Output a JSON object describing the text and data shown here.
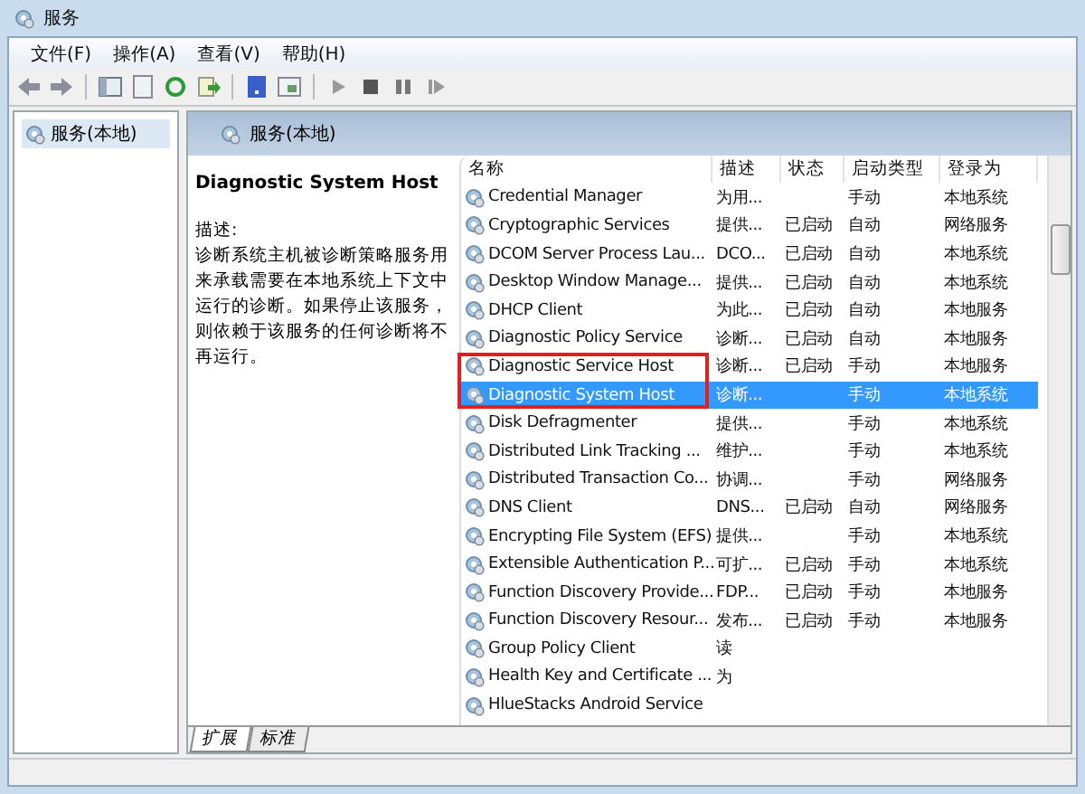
{
  "window": {
    "title": "服务"
  },
  "menu": [
    "文件(F)",
    "操作(A)",
    "查看(V)",
    "帮助(H)"
  ],
  "tree": [
    {
      "label": "服务(本地)",
      "selected": true
    }
  ],
  "pane_title": "服务(本地)",
  "details": {
    "title": "Diagnostic System Host",
    "desc_label": "描述:",
    "description": "诊断系统主机被诊断策略服务用来承载需要在本地系统上下文中运行的诊断。如果停止该服务，则依赖于该服务的任何诊断将不再运行。"
  },
  "table": {
    "columns": [
      "名称",
      "描述",
      "状态",
      "启动类型",
      "登录为"
    ],
    "rows": [
      {
        "cells": [
          "Credential Manager",
          "为用...",
          "",
          "手动",
          "本地系统"
        ],
        "selected": false,
        "highlighted": false
      },
      {
        "cells": [
          "Cryptographic Services",
          "提供...",
          "已启动",
          "自动",
          "网络服务"
        ],
        "selected": false,
        "highlighted": false
      },
      {
        "cells": [
          "DCOM Server Process Lau...",
          "DCO...",
          "已启动",
          "自动",
          "本地系统"
        ],
        "selected": false,
        "highlighted": false
      },
      {
        "cells": [
          "Desktop Window Manage...",
          "提供...",
          "已启动",
          "自动",
          "本地系统"
        ],
        "selected": false,
        "highlighted": false
      },
      {
        "cells": [
          "DHCP Client",
          "为此...",
          "已启动",
          "自动",
          "本地服务"
        ],
        "selected": false,
        "highlighted": false
      },
      {
        "cells": [
          "Diagnostic Policy Service",
          "诊断...",
          "已启动",
          "自动",
          "本地服务"
        ],
        "selected": false,
        "highlighted": false
      },
      {
        "cells": [
          "Diagnostic Service Host",
          "诊断...",
          "已启动",
          "手动",
          "本地服务"
        ],
        "selected": false,
        "highlighted": true
      },
      {
        "cells": [
          "Diagnostic System Host",
          "诊断...",
          "",
          "手动",
          "本地系统"
        ],
        "selected": true,
        "highlighted": true
      },
      {
        "cells": [
          "Disk Defragmenter",
          "提供...",
          "",
          "手动",
          "本地系统"
        ],
        "selected": false,
        "highlighted": false
      },
      {
        "cells": [
          "Distributed Link Tracking ...",
          "维护...",
          "",
          "手动",
          "本地系统"
        ],
        "selected": false,
        "highlighted": false
      },
      {
        "cells": [
          "Distributed Transaction Co...",
          "协调...",
          "",
          "手动",
          "网络服务"
        ],
        "selected": false,
        "highlighted": false
      },
      {
        "cells": [
          "DNS Client",
          "DNS...",
          "已启动",
          "自动",
          "网络服务"
        ],
        "selected": false,
        "highlighted": false
      },
      {
        "cells": [
          "Encrypting File System (EFS)",
          "提供...",
          "",
          "手动",
          "本地系统"
        ],
        "selected": false,
        "highlighted": false
      },
      {
        "cells": [
          "Extensible Authentication P...",
          "可扩...",
          "已启动",
          "手动",
          "本地系统"
        ],
        "selected": false,
        "highlighted": false
      },
      {
        "cells": [
          "Function Discovery Provide...",
          "FDP...",
          "已启动",
          "手动",
          "本地服务"
        ],
        "selected": false,
        "highlighted": false
      },
      {
        "cells": [
          "Function Discovery Resour...",
          "发布...",
          "已启动",
          "手动",
          "本地服务"
        ],
        "selected": false,
        "highlighted": false
      },
      {
        "cells": [
          "Group Policy Client",
          "读",
          "",
          "",
          ""
        ],
        "selected": false,
        "highlighted": false
      },
      {
        "cells": [
          "Health Key and Certificate ...",
          "为",
          "",
          "",
          ""
        ],
        "selected": false,
        "highlighted": false
      },
      {
        "cells": [
          "HlueStacks Android Service",
          "",
          "",
          "",
          ""
        ],
        "selected": false,
        "highlighted": false
      }
    ]
  },
  "bottom_tabs": [
    {
      "label": "扩展",
      "selected": true
    },
    {
      "label": "标准",
      "selected": false
    }
  ]
}
